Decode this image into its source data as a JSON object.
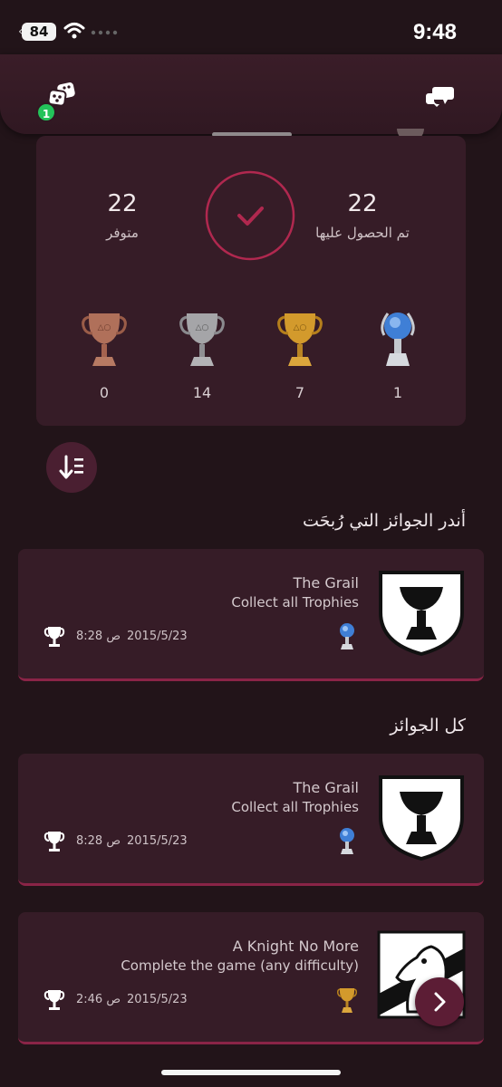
{
  "status_bar": {
    "battery": "84",
    "time": "9:48"
  },
  "header": {
    "notification_count": "1"
  },
  "summary": {
    "earned_count": "22",
    "earned_label": "تم الحصول عليها",
    "available_count": "22",
    "available_label": "متوفر",
    "platinum": "1",
    "gold": "7",
    "silver": "14",
    "bronze": "0"
  },
  "sections": {
    "rarest": "أندر الجوائز التي رُبحَت",
    "all": "كل الجوائز"
  },
  "rarest_trophies": [
    {
      "name": "The Grail",
      "description": "Collect all Trophies",
      "date": "2015/5/23",
      "time": "8:28 ص",
      "grade": "platinum"
    }
  ],
  "all_trophies": [
    {
      "name": "The Grail",
      "description": "Collect all Trophies",
      "date": "2015/5/23",
      "time": "8:28 ص",
      "grade": "platinum"
    },
    {
      "name": "A Knight No More",
      "description": "Complete the game (any difficulty)",
      "date": "2015/5/23",
      "time": "2:46 ص",
      "grade": "gold"
    }
  ],
  "colors": {
    "background": "#221419",
    "card": "#361c27",
    "accent": "#b0284f",
    "badge": "#23c35a"
  }
}
